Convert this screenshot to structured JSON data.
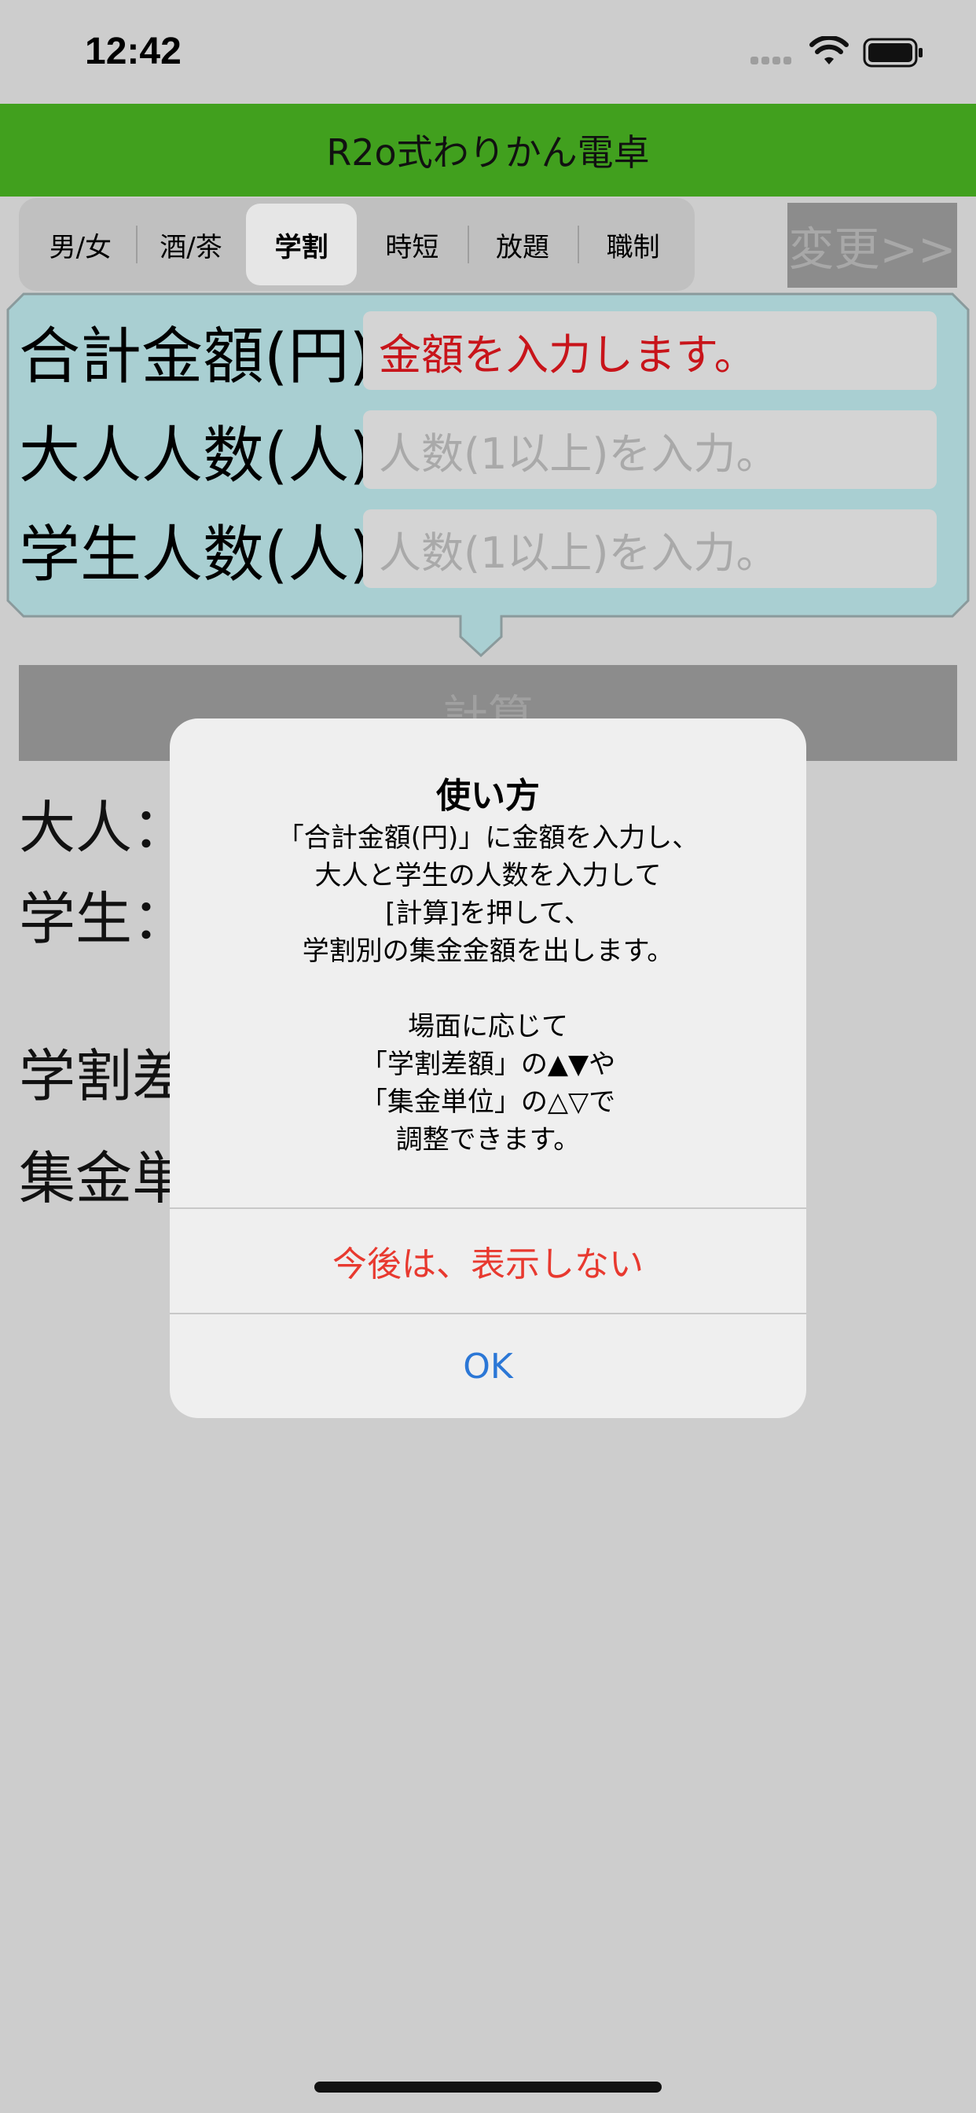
{
  "status": {
    "time": "12:42"
  },
  "header": {
    "title": "R2o式わりかん電卓",
    "bg_color": "#41a01e"
  },
  "segments": [
    "男/女",
    "酒/茶",
    "学割",
    "時短",
    "放題",
    "職制"
  ],
  "selected_segment": "学割",
  "change_button": "変更>>",
  "form": {
    "total_label": "合計金額(円)",
    "total_value": "金額を入力します。",
    "adult_label": "大人人数(人)",
    "adult_placeholder": "人数(1以上)を入力。",
    "student_label": "学生人数(人)",
    "student_placeholder": "人数(1以上)を入力。",
    "bubble_color": "#a9cfd2"
  },
  "calc_button": "計算",
  "results": {
    "adult_prefix": "大人：",
    "student_prefix": "学生：",
    "discount_prefix": "学割差",
    "unit_prefix": "集金単"
  },
  "alert": {
    "title": "使い方",
    "lines": [
      "「合計金額(円)」に金額を入力し、",
      "大人と学生の人数を入力して",
      "[計算]を押して、",
      "学割別の集金金額を出します。",
      "",
      "場面に応じて",
      "「学割差額」の▲▼や",
      "「集金単位」の△▽で",
      "調整できます。"
    ],
    "dont_show_button": "今後は、表示しない",
    "ok_button": "OK"
  }
}
